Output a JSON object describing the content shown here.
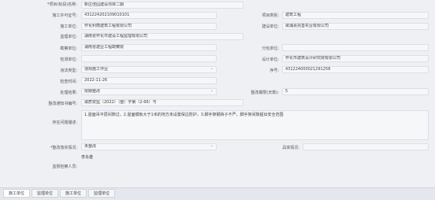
{
  "form": {
    "project_name": {
      "label": "*项目(标段)名称:",
      "value": "新庄佳园建设项目二期"
    },
    "construction_permit": {
      "label": "施工许可证号:",
      "value": "431224202109010101"
    },
    "project_type": {
      "label": "项目类别:",
      "value": "建筑工程"
    },
    "construction_unit": {
      "label": "施工单位:",
      "value": "怀化利丽建筑工程有限公司"
    },
    "builder_unit": {
      "label": "建设单位:",
      "value": "溆浦县完善实业有限公司"
    },
    "supervision_unit": {
      "label": "监理单位:",
      "value": "湖南省怀化市建设工程监理有限公司"
    },
    "survey_unit": {
      "label": "勘察单位:",
      "value": "湖南省建业工程勘察院"
    },
    "subcontract_unit": {
      "label": "分包单位:",
      "value": ""
    },
    "testing_unit": {
      "label": "检测单位:",
      "value": ""
    },
    "design_unit": {
      "label": "设计单位:",
      "value": "怀化市建筑设计研究院有限公司"
    },
    "violation_type": {
      "label": "违法类型:",
      "value": "违规施工作业"
    },
    "serial_no": {
      "label": "序号:",
      "value": "431224000021291258"
    },
    "check_time": {
      "label": "检查时间:",
      "value": "2022-11-26"
    },
    "handling_result": {
      "label": "处理结果:",
      "value": "限期整改"
    },
    "rectify_deadline": {
      "label": "整改期限(天数):",
      "value": "5"
    },
    "rectify_notice_no": {
      "label": "整改通知书编号:",
      "value": "溆质安监（2022）（整）字第（2-66）号"
    },
    "problem_desc": {
      "label": "存在问题描述:",
      "value": "1.屋面吊平层间隙过，2.屋面模板大于1米的地方未设置保边防护，3.脚手架钢挡子不严，脚手架间隙超出安全范围"
    },
    "rectify_status": {
      "label": "*整改落实情况:",
      "value": "未整改"
    },
    "specific_status": {
      "label": "具体情况:",
      "value": ""
    },
    "supervisor": {
      "label": "监督检察人员:",
      "value": "李永雄"
    }
  },
  "tabs": [
    "施工单位",
    "监理单位",
    "施工单位",
    "监理单位"
  ]
}
